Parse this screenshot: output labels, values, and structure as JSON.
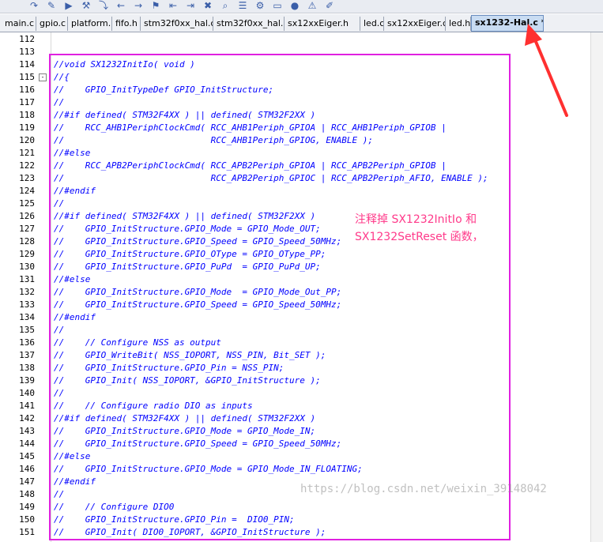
{
  "tabs": [
    {
      "label": "main.c"
    },
    {
      "label": "gpio.c"
    },
    {
      "label": "platform.h"
    },
    {
      "label": "fifo.h"
    },
    {
      "label": "stm32f0xx_hal.c"
    },
    {
      "label": "stm32f0xx_hal.h"
    },
    {
      "label": "sx12xxEiger.h"
    },
    {
      "label": "led.c"
    },
    {
      "label": "sx12xxEiger.c"
    },
    {
      "label": "led.h"
    },
    {
      "label": "sx1232-Hal.c *"
    }
  ],
  "editor": {
    "lines": [
      {
        "num": "112",
        "text": ""
      },
      {
        "num": "113",
        "text": ""
      },
      {
        "num": "114",
        "text": "//void SX1232InitIo( void )"
      },
      {
        "num": "115",
        "text": "//{"
      },
      {
        "num": "116",
        "text": "//    GPIO_InitTypeDef GPIO_InitStructure;"
      },
      {
        "num": "117",
        "text": "//"
      },
      {
        "num": "118",
        "text": "//#if defined( STM32F4XX ) || defined( STM32F2XX )"
      },
      {
        "num": "119",
        "text": "//    RCC_AHB1PeriphClockCmd( RCC_AHB1Periph_GPIOA | RCC_AHB1Periph_GPIOB |"
      },
      {
        "num": "120",
        "text": "//                            RCC_AHB1Periph_GPIOG, ENABLE );"
      },
      {
        "num": "121",
        "text": "//#else"
      },
      {
        "num": "122",
        "text": "//    RCC_APB2PeriphClockCmd( RCC_APB2Periph_GPIOA | RCC_APB2Periph_GPIOB |"
      },
      {
        "num": "123",
        "text": "//                            RCC_APB2Periph_GPIOC | RCC_APB2Periph_AFIO, ENABLE );"
      },
      {
        "num": "124",
        "text": "//#endif"
      },
      {
        "num": "125",
        "text": "//"
      },
      {
        "num": "126",
        "text": "//#if defined( STM32F4XX ) || defined( STM32F2XX )"
      },
      {
        "num": "127",
        "text": "//    GPIO_InitStructure.GPIO_Mode = GPIO_Mode_OUT;"
      },
      {
        "num": "128",
        "text": "//    GPIO_InitStructure.GPIO_Speed = GPIO_Speed_50MHz;"
      },
      {
        "num": "129",
        "text": "//    GPIO_InitStructure.GPIO_OType = GPIO_OType_PP;"
      },
      {
        "num": "130",
        "text": "//    GPIO_InitStructure.GPIO_PuPd  = GPIO_PuPd_UP;"
      },
      {
        "num": "131",
        "text": "//#else"
      },
      {
        "num": "132",
        "text": "//    GPIO_InitStructure.GPIO_Mode  = GPIO_Mode_Out_PP;"
      },
      {
        "num": "133",
        "text": "//    GPIO_InitStructure.GPIO_Speed = GPIO_Speed_50MHz;"
      },
      {
        "num": "134",
        "text": "//#endif"
      },
      {
        "num": "135",
        "text": "//"
      },
      {
        "num": "136",
        "text": "//    // Configure NSS as output"
      },
      {
        "num": "137",
        "text": "//    GPIO_WriteBit( NSS_IOPORT, NSS_PIN, Bit_SET );"
      },
      {
        "num": "138",
        "text": "//    GPIO_InitStructure.GPIO_Pin = NSS_PIN;"
      },
      {
        "num": "139",
        "text": "//    GPIO_Init( NSS_IOPORT, &GPIO_InitStructure );"
      },
      {
        "num": "140",
        "text": "//"
      },
      {
        "num": "141",
        "text": "//    // Configure radio DIO as inputs"
      },
      {
        "num": "142",
        "text": "//#if defined( STM32F4XX ) || defined( STM32F2XX )"
      },
      {
        "num": "143",
        "text": "//    GPIO_InitStructure.GPIO_Mode = GPIO_Mode_IN;"
      },
      {
        "num": "144",
        "text": "//    GPIO_InitStructure.GPIO_Speed = GPIO_Speed_50MHz;"
      },
      {
        "num": "145",
        "text": "//#else"
      },
      {
        "num": "146",
        "text": "//    GPIO_InitStructure.GPIO_Mode = GPIO_Mode_IN_FLOATING;"
      },
      {
        "num": "147",
        "text": "//#endif"
      },
      {
        "num": "148",
        "text": "//"
      },
      {
        "num": "149",
        "text": "//    // Configure DIO0"
      },
      {
        "num": "150",
        "text": "//    GPIO_InitStructure.GPIO_Pin =  DIO0_PIN;"
      },
      {
        "num": "151",
        "text": "//    GPIO_Init( DIO0_IOPORT, &GPIO_InitStructure );"
      }
    ]
  },
  "annotation": {
    "line1": "注释掉 SX1232InitIo 和",
    "line2": "SX1232SetReset 函数，"
  },
  "watermark": "https://blog.csdn.net/weixin_39148042",
  "colors": {
    "code": "#0000ff",
    "highlight_box": "#e020e0",
    "annotation": "#ff3a8a",
    "arrow": "#ff3030",
    "active_tab": "#c9dcf2"
  },
  "icons": [
    "redo-icon",
    "tools-icon",
    "run-icon",
    "build-icon",
    "step-icon",
    "nav-back-icon",
    "nav-forward-icon",
    "bookmark-icon",
    "bookmark-prev-icon",
    "bookmark-next-icon",
    "clear-icon",
    "find-icon",
    "browse-icon",
    "settings-icon",
    "window-icon",
    "stop-icon",
    "debug-icon",
    "edit-icon"
  ]
}
